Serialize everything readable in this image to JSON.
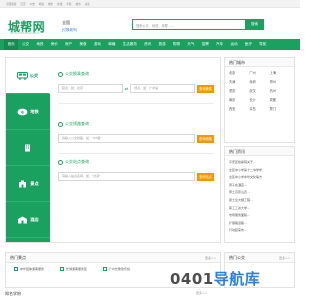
{
  "topbar": {
    "links": [
      "全国搜索",
      "首页",
      "公交",
      "地铁",
      "城市",
      "在线",
      "手机",
      "城市",
      "关注"
    ]
  },
  "header": {
    "logo": "城帮网",
    "site_url": "WWW.CHENGBANG.COM",
    "city": "全国",
    "city_switch": "[切换城市]",
    "search_placeholder": "搜索公交、地铁、房屋......",
    "search_button": "搜索"
  },
  "nav": {
    "items": [
      "首页",
      "公交",
      "地铁",
      "房价",
      "房产",
      "美食",
      "游玩",
      "邮编",
      "生活服务",
      "资讯",
      "旅游",
      "购物",
      "天气",
      "招聘",
      "汽车",
      "运动",
      "医疗",
      "导航"
    ]
  },
  "tabs": [
    {
      "label": "公交",
      "icon": "bus-icon"
    },
    {
      "label": "地铁",
      "icon": "subway-icon"
    },
    {
      "label": "",
      "icon": "building-icon"
    },
    {
      "label": "景点",
      "icon": "landmark-icon"
    },
    {
      "label": "酒店",
      "icon": "hotel-icon"
    }
  ],
  "panels": [
    {
      "title": "公交换乘查询",
      "fields": [
        "起点：如：北京",
        "终点：如：广州站"
      ],
      "button": "查询换乘"
    },
    {
      "title": "公交线路查询",
      "fields": [
        "请输入公交线路，如：\"52路\""
      ],
      "button": "查询线路"
    },
    {
      "title": "公交站点查询",
      "fields": [
        "请输入站点名称，如：\"北京\""
      ],
      "button": "查询站点"
    }
  ],
  "hot_cities": {
    "title": "热门城市",
    "cities": [
      "北京",
      "广州",
      "上海",
      "天津",
      "深圳",
      "郑州",
      "重庆",
      "武汉",
      "杭州",
      "南京",
      "长沙",
      "成都",
      "西安",
      "青岛",
      "厦门"
    ]
  },
  "news": {
    "title": "热门资讯",
    "items": [
      "平安区检察院关于...",
      "全区中小学第十二中学学",
      "全区中小学中华文化等方",
      "男子在酒店...",
      "黄土高原山农...",
      "夏土窑大棚工程...",
      "职工工资大学...",
      "市场服务面貌...",
      "扩容路道路...",
      "行动起来市..."
    ]
  },
  "hot_spots": {
    "title": "热门景点",
    "more": "更多>>",
    "items": [
      "中华园体游客服务",
      "长城游客服务区",
      "广州长隆欢乐谷"
    ]
  },
  "hot_news2": {
    "title": "热门公交",
    "more": "更多>>"
  },
  "bottom": {
    "title": "知名学府",
    "more": "更多>>"
  },
  "watermark": {
    "prefix": "0401",
    "suffix": "导航库"
  },
  "colors": {
    "brand_green": "#1aa05f",
    "button_orange": "#f39800",
    "link_blue": "#3a7fd5"
  }
}
